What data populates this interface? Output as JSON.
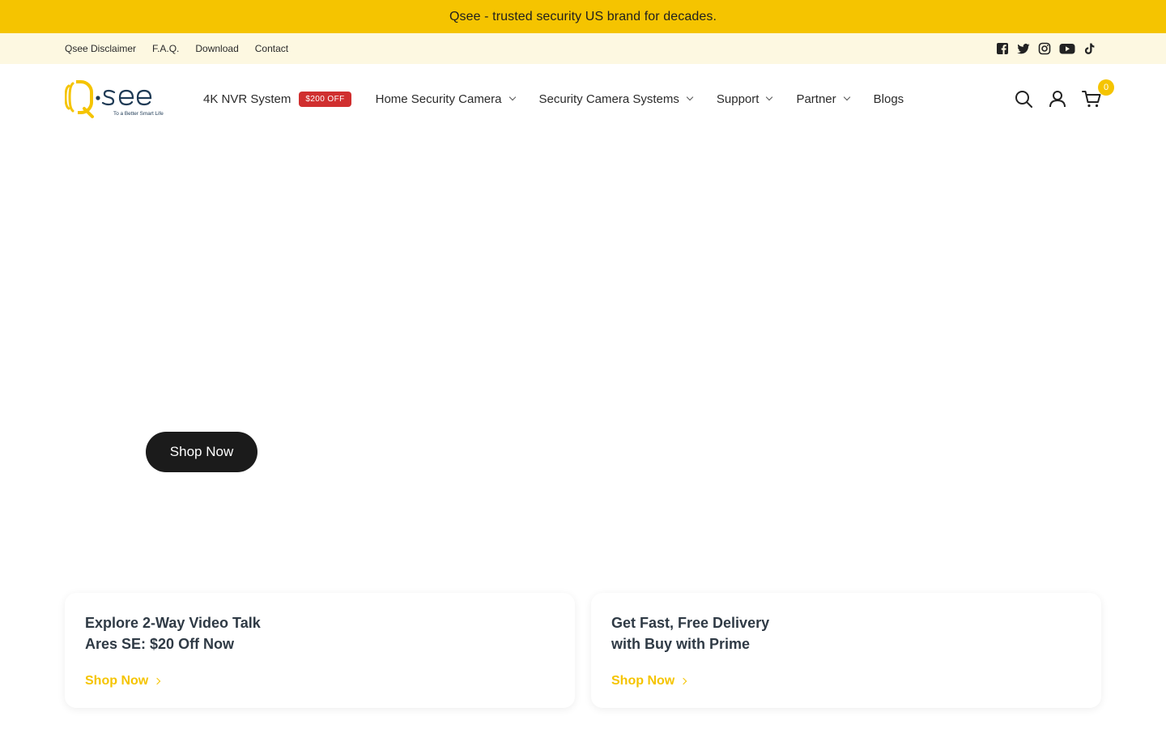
{
  "announcement": "Qsee - trusted security US brand for decades.",
  "top_links": [
    "Qsee Disclaimer",
    "F.A.Q.",
    "Download",
    "Contact"
  ],
  "socials": [
    "facebook-icon",
    "twitter-icon",
    "instagram-icon",
    "youtube-icon",
    "tiktok-icon"
  ],
  "logo": {
    "text": "Q-see",
    "tagline": "To a Better Smart Life"
  },
  "nav": {
    "nvr": "4K NVR System",
    "nvr_badge": "$200 OFF",
    "home_camera": "Home Security Camera",
    "camera_systems": "Security Camera Systems",
    "support": "Support",
    "partner": "Partner",
    "blogs": "Blogs"
  },
  "cart": {
    "count": "0"
  },
  "hero": {
    "button": "Shop Now"
  },
  "cards": [
    {
      "line1": "Explore 2-Way Video Talk",
      "line2": "Ares SE: $20 Off Now",
      "link": "Shop Now"
    },
    {
      "line1": "Get Fast, Free Delivery",
      "line2": "with Buy with Prime",
      "link": "Shop Now"
    }
  ],
  "colors": {
    "accent": "#f5c400",
    "topbar": "#fdf8e1",
    "badge": "#d02f2f",
    "dark_button": "#1b1b1b"
  }
}
